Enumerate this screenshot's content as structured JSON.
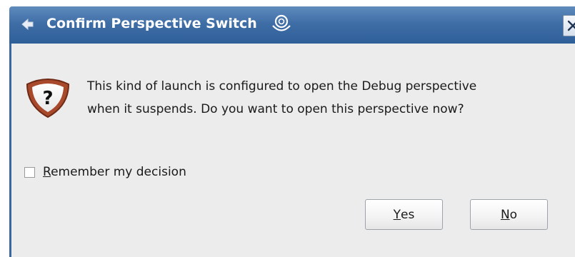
{
  "window": {
    "title": "Confirm Perspective Switch",
    "close_icon": "close-icon",
    "title_icon": "back-arrow-icon",
    "decoration_icon": "swirl-icon"
  },
  "dialog": {
    "icon": "question-icon",
    "message_lines": [
      "This kind of launch is configured to open the Debug perspective",
      "when it suspends. Do you want to open this perspective now?"
    ],
    "remember": {
      "mnemonic": "R",
      "rest": "emember my decision",
      "checked": false
    },
    "buttons": {
      "yes": {
        "mnemonic": "Y",
        "rest": "es"
      },
      "no": {
        "mnemonic": "N",
        "rest": "o"
      }
    }
  },
  "colors": {
    "titlebar": "#3f6ea6",
    "content_bg": "#ececec",
    "icon_ring": "#a0462a"
  }
}
